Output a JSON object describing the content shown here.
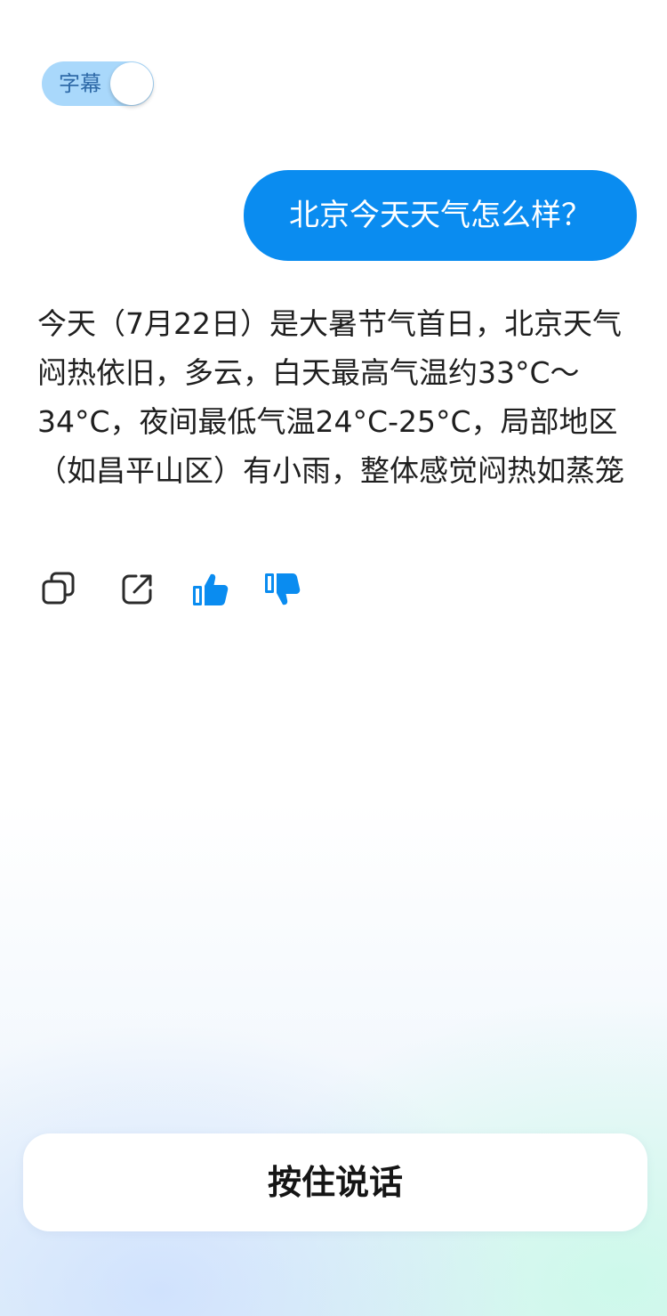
{
  "subtitle_toggle": {
    "label": "字幕",
    "on": true
  },
  "user_message": "北京今天天气怎么样？",
  "assistant_message": "今天（7月22日）是大暑节气首日，北京天气闷热依旧，多云，白天最高气温约33°C～34°C，夜间最低气温24°C-25°C，局部地区（如昌平山区）有小雨，整体感觉闷热如蒸笼",
  "actions": [
    {
      "icon": "copy-icon"
    },
    {
      "icon": "share-icon"
    },
    {
      "icon": "thumbs-up-icon",
      "active": true
    },
    {
      "icon": "thumbs-down-icon",
      "active": true
    }
  ],
  "colors": {
    "accent": "#0a8cf0",
    "toggle_bg": "#a9d8fb",
    "text": "#1f1f1f"
  },
  "talk_button": {
    "label": "按住说话"
  }
}
